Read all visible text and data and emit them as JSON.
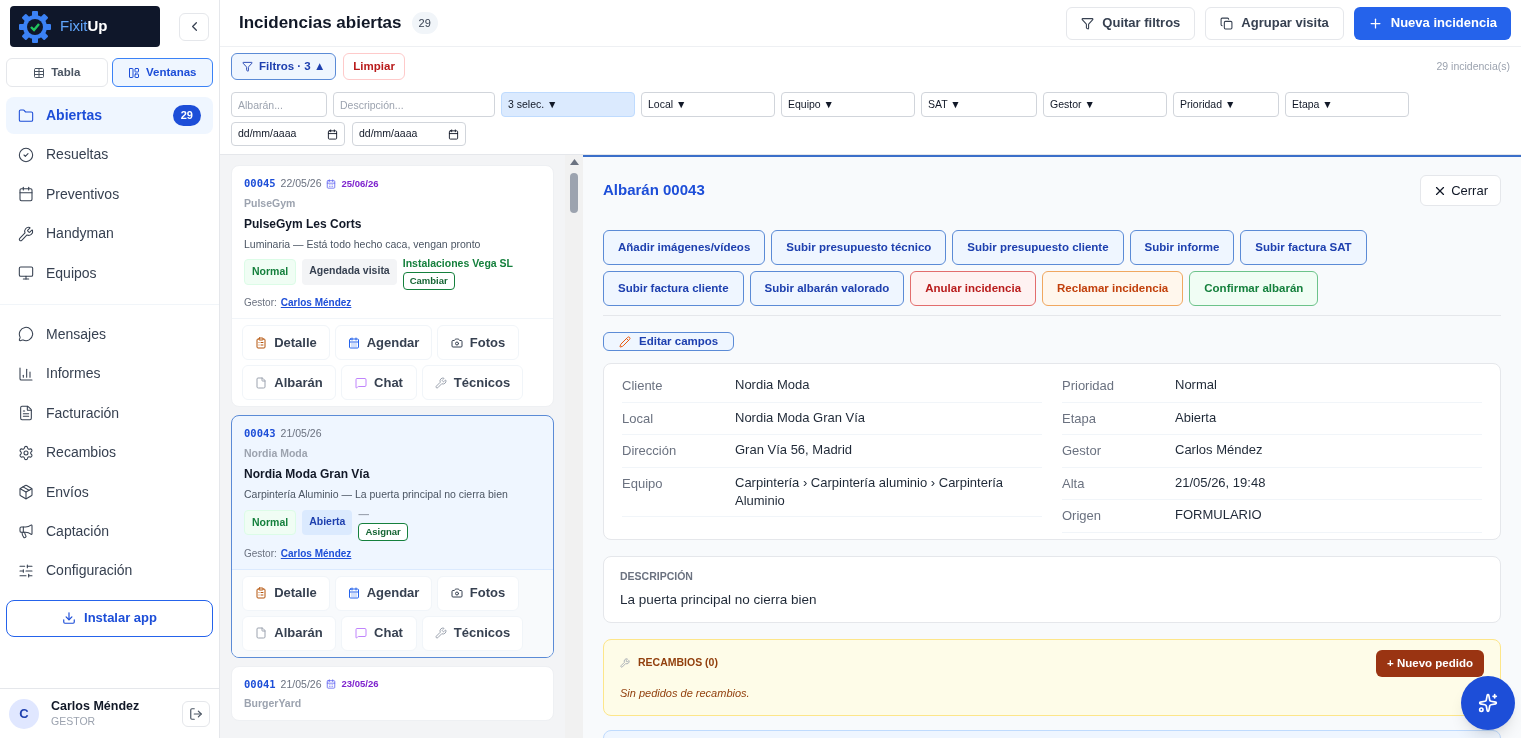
{
  "brand": {
    "name_a": "Fixit",
    "name_b": "Up"
  },
  "view_toggle": [
    {
      "label": "Tabla",
      "selected": false
    },
    {
      "label": "Ventanas",
      "selected": true
    }
  ],
  "nav_groups": [
    [
      {
        "label": "Abiertas",
        "selected": true,
        "badge": "29"
      },
      {
        "label": "Resueltas",
        "selected": false
      },
      {
        "label": "Preventivos",
        "selected": false
      },
      {
        "label": "Handyman",
        "selected": false
      },
      {
        "label": "Equipos",
        "selected": false
      }
    ],
    [
      {
        "label": "Mensajes",
        "selected": false
      },
      {
        "label": "Informes",
        "selected": false
      },
      {
        "label": "Facturación",
        "selected": false
      },
      {
        "label": "Recambios",
        "selected": false
      },
      {
        "label": "Envíos",
        "selected": false
      },
      {
        "label": "Captación",
        "selected": false
      },
      {
        "label": "Configuración",
        "selected": false
      }
    ]
  ],
  "install_button": "Instalar app",
  "user": {
    "initial": "C",
    "name": "Carlos Méndez",
    "role": "GESTOR"
  },
  "header": {
    "title": "Incidencias abiertas",
    "count": "29",
    "buttons": [
      {
        "label": "Quitar filtros",
        "kind": "filter"
      },
      {
        "label": "Agrupar visita",
        "kind": "group"
      },
      {
        "label": "Nueva incidencia",
        "kind": "primary"
      }
    ]
  },
  "filters": {
    "toggle": "Filtros · 3 ▲",
    "clear": "Limpiar",
    "total": "29 incidencia(s)",
    "fields": [
      {
        "kind": "text",
        "placeholder": "Albarán..."
      },
      {
        "kind": "text",
        "placeholder": "Descripción..."
      },
      {
        "kind": "select",
        "value": "3 selec. ▼",
        "active": true
      },
      {
        "kind": "select",
        "value": "Local ▼",
        "active": false
      },
      {
        "kind": "select",
        "value": "Equipo ▼",
        "active": false
      },
      {
        "kind": "select",
        "value": "SAT ▼",
        "active": false
      },
      {
        "kind": "select",
        "value": "Gestor ▼",
        "active": false
      },
      {
        "kind": "select",
        "value": "Prioridad ▼",
        "active": false
      },
      {
        "kind": "select",
        "value": "Etapa ▼",
        "active": false
      }
    ],
    "dates": [
      "dd/mm/aaaa",
      "dd/mm/aaaa"
    ]
  },
  "cards": [
    {
      "id": "00045",
      "date": "22/05/26",
      "scheduled": "25/06/26",
      "client": "PulseGym",
      "local": "PulseGym Les Corts",
      "summary": "Luminaria — Está todo hecho caca, vengan pronto",
      "tags": [
        {
          "label": "Normal",
          "kind": "priority"
        },
        {
          "label": "Agendada visita",
          "kind": "stage-scheduled"
        }
      ],
      "assignee": "Instalaciones Vega SL",
      "assign_button": "Cambiar",
      "gestor_label": "Gestor:",
      "gestor": "Carlos Méndez",
      "selected": false,
      "actions": [
        "Detalle",
        "Agendar",
        "Fotos",
        "Albarán",
        "Chat",
        "Técnicos"
      ]
    },
    {
      "id": "00043",
      "date": "21/05/26",
      "client": "Nordia Moda",
      "local": "Nordia Moda Gran Vía",
      "summary": "Carpintería Aluminio — La puerta principal no cierra bien",
      "tags": [
        {
          "label": "Normal",
          "kind": "priority"
        },
        {
          "label": "Abierta",
          "kind": "stage-open"
        }
      ],
      "assignee": "—",
      "assign_button": "Asignar",
      "gestor_label": "Gestor:",
      "gestor": "Carlos Méndez",
      "selected": true,
      "actions": [
        "Detalle",
        "Agendar",
        "Fotos",
        "Albarán",
        "Chat",
        "Técnicos"
      ]
    },
    {
      "id": "00041",
      "date": "21/05/26",
      "scheduled": "23/05/26",
      "client": "BurgerYard",
      "selected": false
    }
  ],
  "detail": {
    "title": "Albarán 00043",
    "close": "Cerrar",
    "actions": [
      {
        "label": "Añadir imágenes/vídeos",
        "kind": "neutral"
      },
      {
        "label": "Subir presupuesto técnico",
        "kind": "neutral"
      },
      {
        "label": "Subir presupuesto cliente",
        "kind": "neutral"
      },
      {
        "label": "Subir informe",
        "kind": "neutral"
      },
      {
        "label": "Subir factura SAT",
        "kind": "neutral"
      },
      {
        "label": "Subir factura cliente",
        "kind": "neutral"
      },
      {
        "label": "Subir albarán valorado",
        "kind": "neutral"
      },
      {
        "label": "Anular incidencia",
        "kind": "danger"
      },
      {
        "label": "Reclamar incidencia",
        "kind": "warning"
      },
      {
        "label": "Confirmar albarán",
        "kind": "success"
      }
    ],
    "edit": "Editar campos",
    "fields_left": [
      {
        "label": "Cliente",
        "value": "Nordia Moda"
      },
      {
        "label": "Local",
        "value": "Nordia Moda Gran Vía"
      },
      {
        "label": "Dirección",
        "value": "Gran Vía 56, Madrid"
      },
      {
        "label": "Equipo",
        "value": "Carpintería › Carpintería aluminio › Carpintería Aluminio"
      }
    ],
    "fields_right": [
      {
        "label": "Prioridad",
        "value": "Normal"
      },
      {
        "label": "Etapa",
        "value": "Abierta"
      },
      {
        "label": "Gestor",
        "value": "Carlos Méndez"
      },
      {
        "label": "Alta",
        "value": "21/05/26, 19:48"
      },
      {
        "label": "Origen",
        "value": "FORMULARIO"
      }
    ],
    "description": {
      "heading": "DESCRIPCIÓN",
      "text": "La puerta principal no cierra bien"
    },
    "spares": {
      "heading": "RECAMBIOS (0)",
      "button": "+ Nuevo pedido",
      "empty": "Sin pedidos de recambios."
    }
  }
}
